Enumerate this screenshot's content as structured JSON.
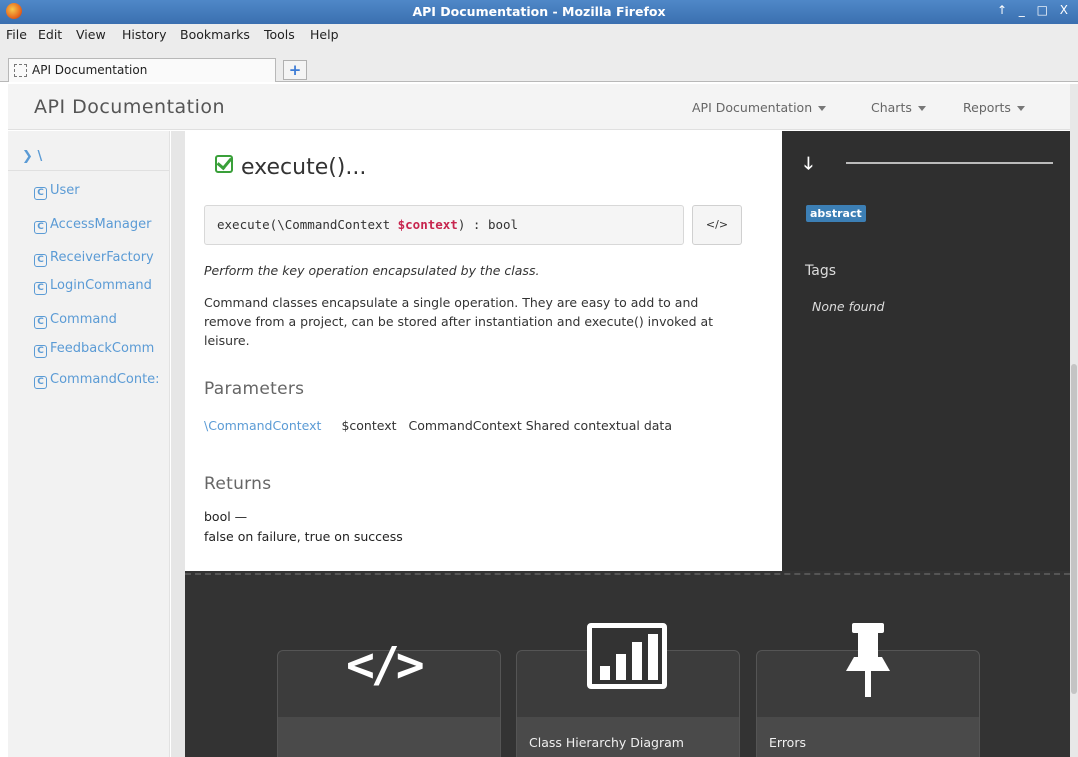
{
  "window": {
    "title": "API Documentation - Mozilla Firefox",
    "controls": "↑ _ □ X"
  },
  "menubar": [
    "File",
    "Edit",
    "View",
    "History",
    "Bookmarks",
    "Tools",
    "Help"
  ],
  "tab": {
    "label": "API Documentation",
    "new_tab_symbol": "+"
  },
  "header": {
    "brand": "API Documentation",
    "nav": [
      "API Documentation",
      "Charts",
      "Reports"
    ]
  },
  "sidebar": {
    "namespace": "\\",
    "items": [
      {
        "icon": "class-icon",
        "label": "User"
      },
      {
        "icon": "class-icon",
        "label": "AccessManager"
      },
      {
        "icon": "class-icon",
        "label": "ReceiverFactory"
      },
      {
        "icon": "class-icon",
        "label": "LoginCommand"
      },
      {
        "icon": "class-icon",
        "label": "Command"
      },
      {
        "icon": "class-icon",
        "label": "FeedbackComm"
      },
      {
        "icon": "class-icon",
        "label": "CommandConte:"
      }
    ]
  },
  "method": {
    "title": "execute()...",
    "signature_prefix": "execute(\\CommandContext ",
    "signature_param": "$context",
    "signature_suffix": ") : bool",
    "source_button": "</>",
    "summary": "Perform the key operation encapsulated by the class.",
    "description": "Command classes encapsulate a single operation. They are easy to add to and remove from a project, can be stored after instantiation and execute() invoked at leisure.",
    "parameters_heading": "Parameters",
    "parameters": [
      {
        "type": "\\CommandContext",
        "name": "$context",
        "description": "CommandContext Shared contextual data"
      }
    ],
    "returns_heading": "Returns",
    "returns_type": "bool —",
    "returns_description": "false on failure, true on success"
  },
  "details": {
    "badge": "abstract",
    "tags_heading": "Tags",
    "tags_empty": "None found"
  },
  "footer_cards": [
    {
      "icon": "code-icon",
      "label": ""
    },
    {
      "icon": "bar-chart-icon",
      "label": "Class Hierarchy Diagram"
    },
    {
      "icon": "pushpin-icon",
      "label": "Errors"
    }
  ],
  "colors": {
    "link": "#5b9bd5",
    "check": "#3aa03a",
    "param_highlight": "#c7254e",
    "badge": "#3c7fb5",
    "dark_panel": "#2f2f2f"
  }
}
